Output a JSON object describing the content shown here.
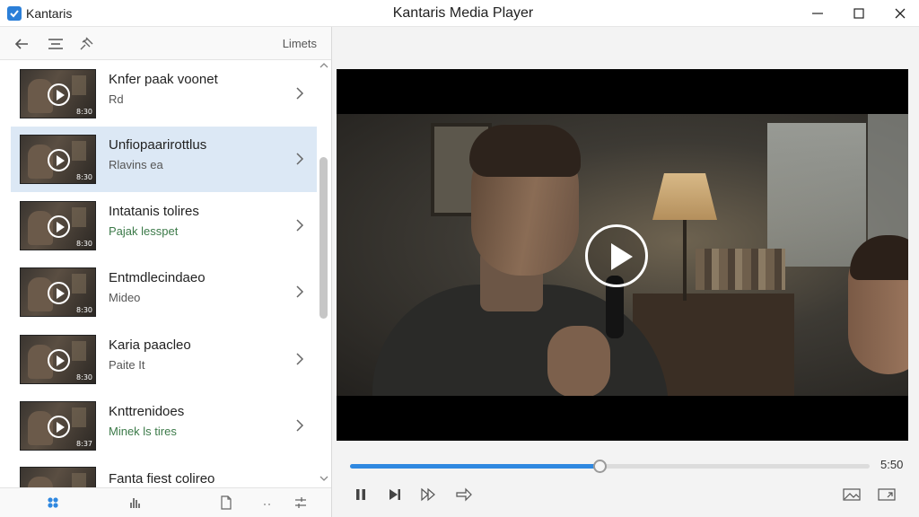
{
  "window": {
    "app_name": "Kantaris",
    "title": "Kantaris Media Player",
    "icons": {
      "minimize": "minimize-icon",
      "maximize": "maximize-icon",
      "close": "close-icon"
    }
  },
  "sidebar": {
    "toolbar": {
      "back_icon": "arrow-left-icon",
      "menu_icon": "list-menu-icon",
      "pin_icon": "pin-icon",
      "label": "Limets"
    },
    "items": [
      {
        "title": "Knfer paak voonet",
        "subtitle": "Rd",
        "duration": "8:30",
        "selected": false
      },
      {
        "title": "Unfiopaarirottlus",
        "subtitle": "Rlavins ea",
        "duration": "8:30",
        "selected": true
      },
      {
        "title": "Intatanis tolires",
        "subtitle": "Pajak lesspet",
        "duration": "8:30",
        "selected": false,
        "subtitle_green": true
      },
      {
        "title": "Entmdlecindaeo",
        "subtitle": "Mideo",
        "duration": "8:30",
        "selected": false
      },
      {
        "title": "Karia paacleo",
        "subtitle": "Paite It",
        "duration": "8:30",
        "selected": false
      },
      {
        "title": "Knttrenidoes",
        "subtitle": "Minek ls tires",
        "duration": "8:37",
        "selected": false,
        "subtitle_green": true
      },
      {
        "title": "Fanta fiest colireo",
        "subtitle": "",
        "duration": "",
        "selected": false
      }
    ],
    "bottom_icons": [
      "grid-icon",
      "equalizer-icon",
      "document-icon",
      "dots-icon",
      "sliders-icon"
    ]
  },
  "player": {
    "progress": 0.48,
    "time": "5:50",
    "controls": [
      "pause-icon",
      "next-icon",
      "fast-forward-icon",
      "forward-arrow-icon"
    ],
    "right_controls": [
      "screenshot-icon",
      "cast-icon"
    ]
  }
}
